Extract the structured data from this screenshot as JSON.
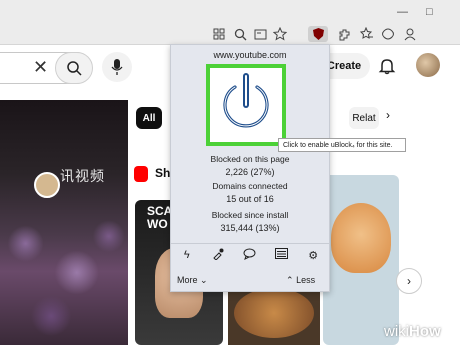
{
  "browser": {
    "toolbar_icons": [
      "grid-icon",
      "zoom-icon",
      "reading-view-icon",
      "favorite-star-icon",
      "ublock-shield-icon",
      "extensions-puzzle-icon",
      "favorites-icon",
      "copilot-icon",
      "profile-icon"
    ],
    "window_controls": [
      "—",
      "□"
    ]
  },
  "youtube": {
    "create_label": "Create",
    "chips": {
      "all": "All",
      "related": "Relat"
    },
    "shorts_label": "Sh",
    "hero_overlay_text": "讯视频",
    "thumb1_title": "SCA\nWO"
  },
  "ublock": {
    "hostname": "www.youtube.com",
    "blocked_on_page_label": "Blocked on this page",
    "blocked_on_page_value": "2,226 (27%)",
    "domains_connected_label": "Domains connected",
    "domains_connected_value": "15 out of 16",
    "blocked_since_install_label": "Blocked since install",
    "blocked_since_install_value": "315,444 (13%)",
    "more_label": "More",
    "less_label": "Less",
    "tooltip": "Click to enable uBlock₄ for this site.",
    "power_border_color": "#4cd137",
    "power_icon_color": "#1f4e8c"
  },
  "watermark": {
    "wiki": "wiki",
    "how": "How"
  }
}
